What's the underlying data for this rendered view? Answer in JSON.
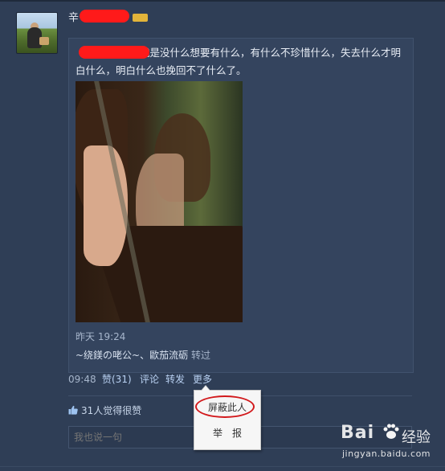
{
  "post": {
    "user_name": "辛",
    "vip_badge": "",
    "repost_text": "就是没什么想要有什么，有什么不珍惜什么，失去什么才明白什么，明白什么也挽回不了什么了。",
    "repost_time": "昨天 19:24",
    "repost_users": "~绕鎂の咾公~、歐茄流砺",
    "repost_suffix": "转过"
  },
  "actions": {
    "time": "09:48",
    "like": "赞(31)",
    "comment": "评论",
    "forward": "转发",
    "more": "更多"
  },
  "likes_line": "31人觉得很赞",
  "comment_input": {
    "placeholder": "我也说一句"
  },
  "menu": {
    "block": "屏蔽此人",
    "report": "举报"
  },
  "watermark": {
    "logo": "Bai",
    "word": "经验",
    "url": "jingyan.baidu.com"
  },
  "colors": {
    "background": "#2f3e56",
    "link": "#b9d1f2",
    "highlight": "#d2191c"
  }
}
